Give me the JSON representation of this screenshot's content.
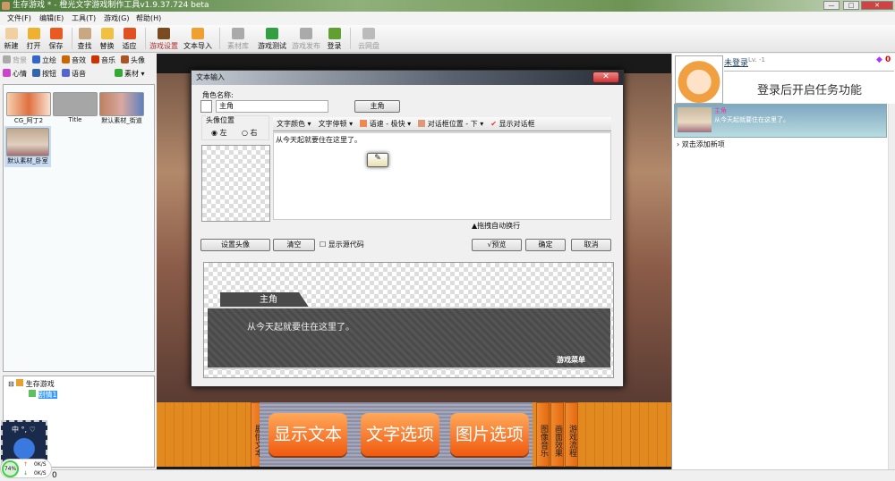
{
  "window": {
    "title": "生存游戏 * - 橙光文字游戏制作工具v1.9.37.724 beta",
    "controls": [
      "—",
      "□",
      "✕"
    ]
  },
  "menu": [
    "文件(F)",
    "编辑(E)",
    "工具(T)",
    "游戏(G)",
    "帮助(H)"
  ],
  "toolbar": [
    {
      "label": "新建",
      "icon": "new-file-icon",
      "color": "#f0d0a0"
    },
    {
      "label": "打开",
      "icon": "folder-icon",
      "color": "#f0b030"
    },
    {
      "label": "保存",
      "icon": "save-icon",
      "color": "#e85a20"
    },
    {
      "label": "查找",
      "icon": "search-icon",
      "color": "#c8a880"
    },
    {
      "label": "替换",
      "icon": "replace-icon",
      "color": "#f0c040"
    },
    {
      "label": "适应",
      "icon": "fit-icon",
      "color": "#e05020"
    },
    {
      "label": "游戏设置",
      "icon": "gear-icon",
      "color": "#7a4a20",
      "highlight": true
    },
    {
      "label": "文本导入",
      "icon": "text-import-icon",
      "color": "#f0a030"
    },
    {
      "label": "素材库",
      "icon": "library-icon",
      "color": "#aaaaaa",
      "disabled": true
    },
    {
      "label": "游戏测试",
      "icon": "play-test-icon",
      "color": "#30a040"
    },
    {
      "label": "游戏发布",
      "icon": "publish-icon",
      "color": "#aaaaaa",
      "disabled": true
    },
    {
      "label": "登录",
      "icon": "login-star-icon",
      "color": "#60a030"
    },
    {
      "label": "云网盘",
      "icon": "cloud-drive-icon",
      "color": "#bbbbbb",
      "disabled": true
    }
  ],
  "left": {
    "tabs_row1": [
      {
        "label": "背景",
        "icon": "background-icon",
        "disabled": true
      },
      {
        "label": "立绘",
        "icon": "portrait-icon"
      },
      {
        "label": "音效",
        "icon": "sound-icon"
      },
      {
        "label": "音乐",
        "icon": "music-icon"
      },
      {
        "label": "头像",
        "icon": "avatar-icon"
      }
    ],
    "tabs_row2": [
      {
        "label": "心情",
        "icon": "mood-icon"
      },
      {
        "label": "按钮",
        "icon": "button-icon"
      },
      {
        "label": "语音",
        "icon": "voice-icon"
      },
      {
        "label": "素材 ▾",
        "icon": "material-icon"
      }
    ],
    "thumbnails": [
      {
        "label": "CG_阿丁2"
      },
      {
        "label": "Title"
      },
      {
        "label": "默认素材_街道"
      },
      {
        "label": "默认素材_卧室",
        "selected": true
      }
    ],
    "tree": {
      "root": "生存游戏",
      "child": "剧情1"
    }
  },
  "network": {
    "percent": "74%",
    "up": "0K/S",
    "down": "0K/S",
    "tray": "中 °, ♡"
  },
  "stage": {
    "buttons": [
      "显示文本",
      "文字选项",
      "图片选项"
    ],
    "vtabs_left": [
      "剧情文本"
    ],
    "vtabs_right": [
      "图像音乐",
      "画面效果",
      "游戏流程"
    ],
    "menu_text": "单"
  },
  "right": {
    "user": "未登录",
    "level": "Lv. -1",
    "gems": "0",
    "task_msg": "登录后开启任务功能",
    "entry": {
      "name": "主角",
      "text": "从今天起就要住在这里了。"
    },
    "add_item": "双击添加新项"
  },
  "dialog": {
    "title": "文本输入",
    "close": "✕",
    "name_label": "角色名称:",
    "name_value": "主角",
    "name_button": "主角",
    "avatar_pos_label": "头像位置",
    "left": "左",
    "right": "右",
    "format": [
      "文字颜色 ▾",
      "文字停顿 ▾",
      "语速 - 极快 ▾",
      "对话框位置 - 下 ▾",
      "显示对话框"
    ],
    "text": "从今天起就要住在这里了。",
    "autowrap": "▲拖拽自动换行",
    "set_avatar": "设置头像",
    "clear": "清空",
    "show_source": "显示源代码",
    "preview": "√预览",
    "ok": "确定",
    "cancel": "取消",
    "preview_name": "主角",
    "preview_text": "从今天起就要住在这里了。",
    "preview_menu": "游戏菜单"
  },
  "status": {
    "value": "0"
  }
}
